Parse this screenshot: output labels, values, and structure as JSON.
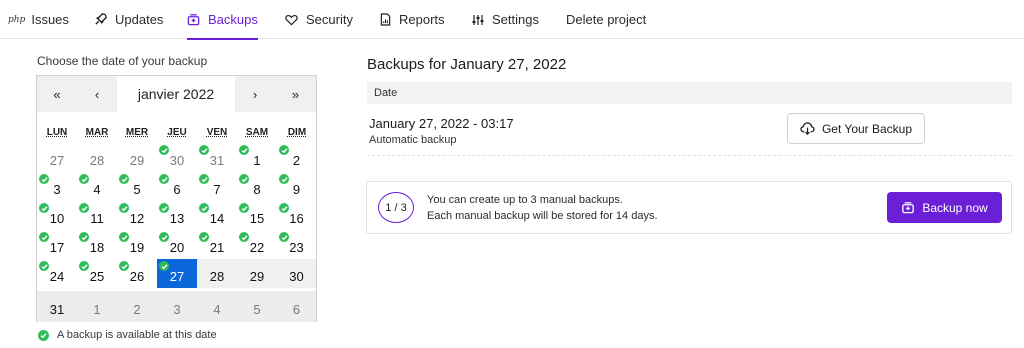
{
  "tabs": [
    {
      "label": "Issues",
      "icon": "php-icon",
      "active": false
    },
    {
      "label": "Updates",
      "icon": "rocket-icon",
      "active": false
    },
    {
      "label": "Backups",
      "icon": "backup-icon",
      "active": true
    },
    {
      "label": "Security",
      "icon": "heart-icon",
      "active": false
    },
    {
      "label": "Reports",
      "icon": "report-icon",
      "active": false
    },
    {
      "label": "Settings",
      "icon": "sliders-icon",
      "active": false
    },
    {
      "label": "Delete project",
      "icon": "",
      "active": false
    }
  ],
  "php_icon_text": "php",
  "calendar": {
    "label": "Choose the date of your backup",
    "nav_prev_year": "«",
    "nav_prev_month": "‹",
    "month": "janvier 2022",
    "nav_next_month": "›",
    "nav_next_year": "»",
    "weekdays": [
      "LUN",
      "MAR",
      "MER",
      "JEU",
      "VEN",
      "SAM",
      "DIM"
    ],
    "weeks": [
      [
        "27",
        "28",
        "29",
        "30",
        "31",
        "1",
        "2"
      ],
      [
        "3",
        "4",
        "5",
        "6",
        "7",
        "8",
        "9"
      ],
      [
        "10",
        "11",
        "12",
        "13",
        "14",
        "15",
        "16"
      ],
      [
        "17",
        "18",
        "19",
        "20",
        "21",
        "22",
        "23"
      ],
      [
        "24",
        "25",
        "26",
        "27",
        "28",
        "29",
        "30"
      ],
      [
        "31",
        "1",
        "2",
        "3",
        "4",
        "5",
        "6"
      ]
    ],
    "selected_day": "27",
    "legend": "A backup is available at this date"
  },
  "backups": {
    "title": "Backups for January 27, 2022",
    "column_date": "Date",
    "rows": [
      {
        "date": "January 27, 2022 - 03:17",
        "type": "Automatic backup",
        "button": "Get Your Backup"
      }
    ]
  },
  "manual": {
    "counter": "1 / 3",
    "line1": "You can create up to 3 manual backups.",
    "line2": "Each manual backup will be stored for 14 days.",
    "button": "Backup now"
  },
  "colors": {
    "accent": "#6b1fd6",
    "selected_day": "#0b66d9",
    "available_dot": "#2ebd59"
  }
}
